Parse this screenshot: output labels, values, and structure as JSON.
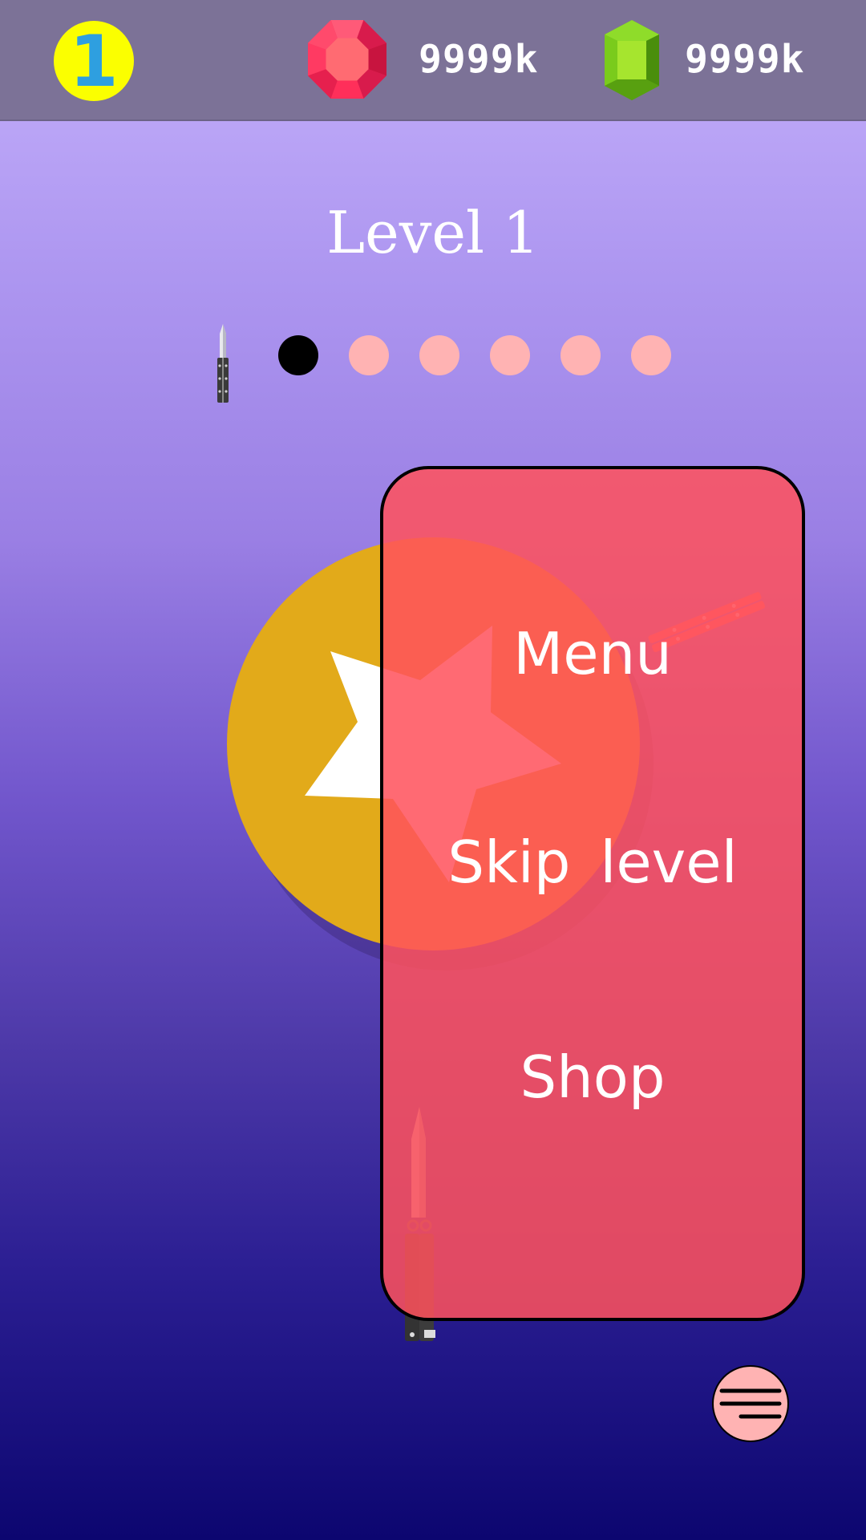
{
  "header": {
    "level_number": "1",
    "ruby_amount": "9999k",
    "emerald_amount": "9999k"
  },
  "level": {
    "title": "Level 1",
    "stages_total": 6,
    "stage_current": 1
  },
  "menu": {
    "items": [
      {
        "label": "Menu"
      },
      {
        "label": "Skip level"
      },
      {
        "label": "Shop"
      }
    ]
  },
  "colors": {
    "top_bar": "#7c7297",
    "level_badge": "#fbff00",
    "level_badge_text": "#2e9fe0",
    "ruby": "#f0305a",
    "emerald": "#6fc41a",
    "stage_dot_active": "#000000",
    "stage_dot_inactive": "#ffb3b3",
    "target": "#e2aa1a",
    "menu_panel": "#ff525c",
    "hamburger_button": "#ffb3b3"
  },
  "icons": {
    "currency_1": "ruby-gem-icon",
    "currency_2": "emerald-gem-icon",
    "progress": "butterfly-knife-icon",
    "menu_button": "hamburger-icon"
  }
}
